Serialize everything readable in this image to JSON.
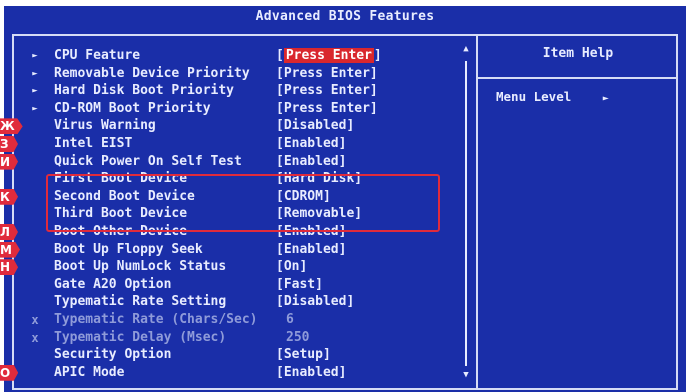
{
  "title": "Advanced BIOS Features",
  "help": {
    "title": "Item Help",
    "menu_level": "Menu Level",
    "menu_arrow": "►"
  },
  "rows": [
    {
      "mark": "►",
      "label": "CPU Feature",
      "value": "[Press Enter]",
      "highlight": true
    },
    {
      "mark": "►",
      "label": "Removable Device Priority",
      "value": "[Press Enter]"
    },
    {
      "mark": "►",
      "label": "Hard Disk Boot Priority",
      "value": "[Press Enter]"
    },
    {
      "mark": "►",
      "label": "CD-ROM Boot Priority",
      "value": "[Press Enter]"
    },
    {
      "mark": "",
      "label": "Virus Warning",
      "value": "[Disabled]"
    },
    {
      "mark": "",
      "label": "Intel EIST",
      "value": "[Enabled]"
    },
    {
      "mark": "",
      "label": "Quick Power On Self Test",
      "value": "[Enabled]"
    },
    {
      "mark": "",
      "label": "First Boot Device",
      "value": "[Hard Disk]"
    },
    {
      "mark": "",
      "label": "Second Boot Device",
      "value": "[CDROM]"
    },
    {
      "mark": "",
      "label": "Third Boot Device",
      "value": "[Removable]"
    },
    {
      "mark": "",
      "label": "Boot Other Device",
      "value": "[Enabled]"
    },
    {
      "mark": "",
      "label": "Boot Up Floppy Seek",
      "value": "[Enabled]"
    },
    {
      "mark": "",
      "label": "Boot Up NumLock Status",
      "value": "[On]"
    },
    {
      "mark": "",
      "label": "Gate A20 Option",
      "value": "[Fast]"
    },
    {
      "mark": "",
      "label": "Typematic Rate Setting",
      "value": "[Disabled]"
    },
    {
      "mark": "x",
      "label": "Typematic Rate (Chars/Sec)",
      "value": "6",
      "dim": true
    },
    {
      "mark": "x",
      "label": "Typematic Delay (Msec)",
      "value": "250",
      "dim": true
    },
    {
      "mark": "",
      "label": "Security Option",
      "value": "[Setup]"
    },
    {
      "mark": "",
      "label": "APIC Mode",
      "value": "[Enabled]"
    }
  ],
  "scroll": {
    "up": "▲",
    "down": "▼"
  },
  "markers": [
    {
      "letter": "Ж",
      "row": 4
    },
    {
      "letter": "З",
      "row": 5
    },
    {
      "letter": "И",
      "row": 6
    },
    {
      "letter": "К",
      "row": 8
    },
    {
      "letter": "Л",
      "row": 10
    },
    {
      "letter": "М",
      "row": 11
    },
    {
      "letter": "Н",
      "row": 12
    },
    {
      "letter": "О",
      "row": 18
    }
  ],
  "colors": {
    "background": "#1a2ea8",
    "text": "#e8ecff",
    "dim_text": "#8f9bd9",
    "accent": "#e02b3c"
  }
}
